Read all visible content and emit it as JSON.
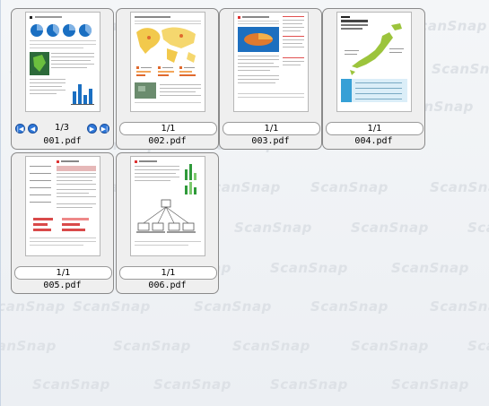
{
  "watermark_text": "ScanSnap",
  "documents": [
    {
      "file_name": "001.pdf",
      "page_indicator": "1/3",
      "has_page_nav": true
    },
    {
      "file_name": "002.pdf",
      "page_indicator": "1/1",
      "has_page_nav": false
    },
    {
      "file_name": "003.pdf",
      "page_indicator": "1/1",
      "has_page_nav": false
    },
    {
      "file_name": "004.pdf",
      "page_indicator": "1/1",
      "has_page_nav": false
    },
    {
      "file_name": "005.pdf",
      "page_indicator": "1/1",
      "has_page_nav": false
    },
    {
      "file_name": "006.pdf",
      "page_indicator": "1/1",
      "has_page_nav": false
    }
  ],
  "nav_icons": {
    "first": "first-page-icon",
    "prev": "previous-page-icon",
    "next": "next-page-icon",
    "last": "last-page-icon"
  },
  "colors": {
    "nav_button": "#2f77d8",
    "tile_background": "#efefef",
    "viewer_background": "#eef2f6",
    "watermark": "#dde1e6"
  }
}
